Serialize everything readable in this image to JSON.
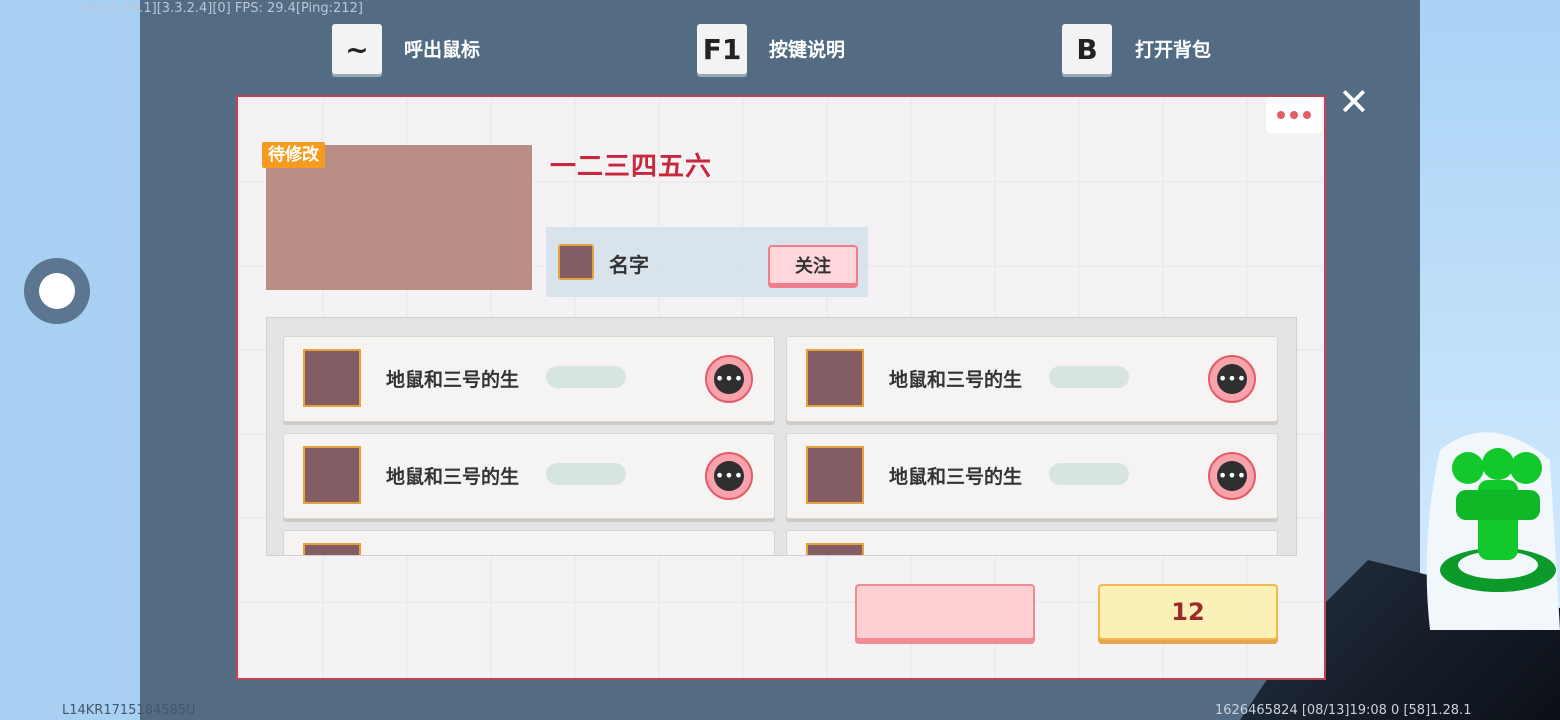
{
  "hud": {
    "version_text": "Ver[1.26.1][3.3.2.4][0] FPS: 29.4[Ping:212]",
    "bottom_left_id": "L14KR1715184585U",
    "bottom_right_info": "1626465824   [08/13]19:08 0   [58]1.28.1"
  },
  "shortcuts": [
    {
      "key": "~",
      "label": "呼出鼠标"
    },
    {
      "key": "F1",
      "label": "按键说明"
    },
    {
      "key": "B",
      "label": "打开背包"
    }
  ],
  "panel": {
    "tag": "待修改",
    "title": "一二三四五六",
    "name_label": "名字",
    "follow_label": "关注",
    "more_dots": "•••",
    "close_symbol": "✕",
    "members": [
      {
        "name": "地鼠和三号的生"
      },
      {
        "name": "地鼠和三号的生"
      },
      {
        "name": "地鼠和三号的生"
      },
      {
        "name": "地鼠和三号的生"
      }
    ],
    "chat_symbol": "•••",
    "pink_button_label": "",
    "yellow_button_label": "12"
  },
  "colors": {
    "panel_border": "#c14455",
    "title": "#c8283b",
    "tag": "#f49b20",
    "avatar": "#b88e86",
    "member_avatar": "#845c64"
  }
}
